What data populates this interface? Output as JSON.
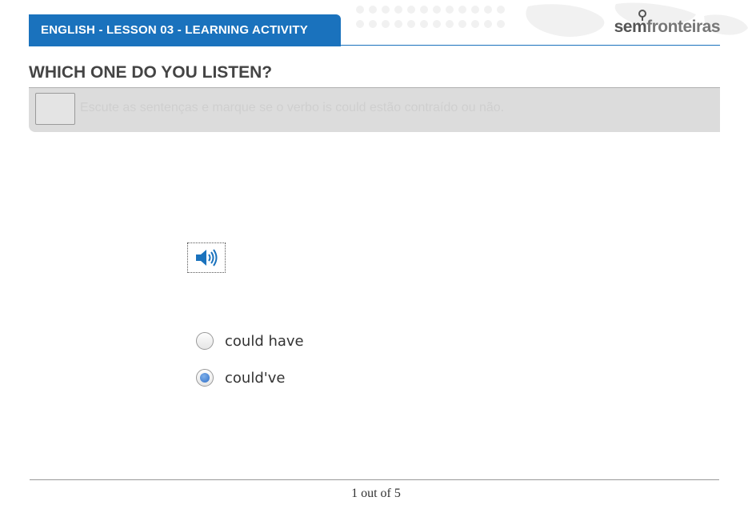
{
  "header": {
    "title": "ENGLISH - LESSON 03 - LEARNING ACTIVITY",
    "logo_part1": "sem",
    "logo_part2": "fronteiras"
  },
  "page": {
    "title": "WHICH ONE DO YOU LISTEN?"
  },
  "instruction": {
    "text": "Escute as sentenças e marque se o verbo is could estão contraído ou não.",
    "icon": "placeholder-icon"
  },
  "audio": {
    "icon": "speaker-icon",
    "color": "#1a72bd"
  },
  "options": [
    {
      "label": "could have",
      "selected": false
    },
    {
      "label": "could've",
      "selected": true
    }
  ],
  "pager": {
    "text": "1 out of 5"
  },
  "colors": {
    "brand_blue": "#1a72bd",
    "instruction_bg": "#dcdcdc",
    "radio_selected": "#2f6fc8"
  }
}
